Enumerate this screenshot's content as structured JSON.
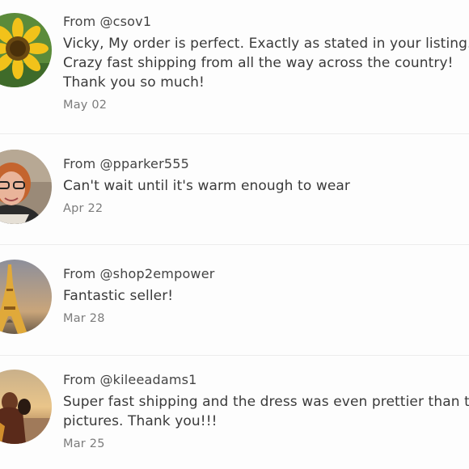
{
  "reviews": [
    {
      "from_prefix": "From",
      "username": "@csov1",
      "message_lines": [
        "Vicky, My order is perfect. Exactly as stated in your listing.",
        "Crazy fast shipping from all the way across the country!",
        "Thank you so much!"
      ],
      "date": "May 02",
      "avatar_icon": "sunflower-avatar"
    },
    {
      "from_prefix": "From",
      "username": "@pparker555",
      "message_lines": [
        "Can't wait until it's warm enough to wear"
      ],
      "date": "Apr 22",
      "avatar_icon": "woman-with-glasses-avatar"
    },
    {
      "from_prefix": "From",
      "username": "@shop2empower",
      "message_lines": [
        "Fantastic seller!"
      ],
      "date": "Mar 28",
      "avatar_icon": "eiffel-tower-avatar"
    },
    {
      "from_prefix": "From",
      "username": "@kileeadams1",
      "message_lines": [
        "Super fast shipping and the dress was even prettier than the",
        "pictures. Thank you!!!"
      ],
      "date": "Mar 25",
      "avatar_icon": "couple-sunset-avatar"
    }
  ],
  "colors": {
    "background": "#fdfdfd",
    "text": "#3a3a3a",
    "date": "#7c7c7c",
    "divider": "#ececec"
  }
}
